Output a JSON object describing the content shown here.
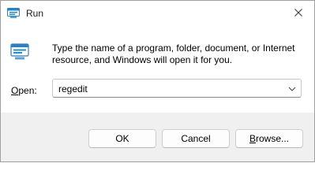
{
  "window": {
    "title": "Run",
    "title_icon": "run-icon",
    "close_icon": "close-icon"
  },
  "content": {
    "description": "Type the name of a program, folder, document, or Internet resource, and Windows will open it for you.",
    "icon": "run-icon",
    "open_label_accel": "O",
    "open_label_rest": "pen:",
    "open_value": "regedit",
    "dropdown_icon": "chevron-down-icon"
  },
  "buttons": {
    "ok": "OK",
    "cancel": "Cancel",
    "browse_accel": "B",
    "browse_rest": "rowse..."
  },
  "colors": {
    "footer_bg": "#f0f0f0",
    "icon_blue": "#1e90d6"
  }
}
